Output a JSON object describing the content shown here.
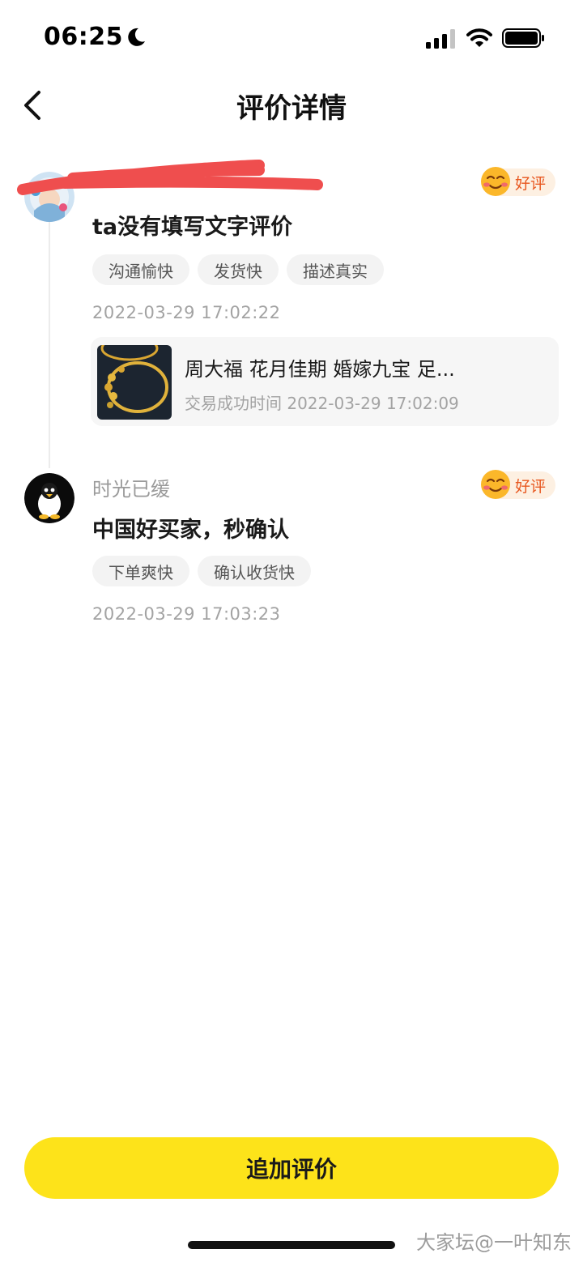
{
  "status_bar": {
    "time": "06:25",
    "icons": [
      "moon-icon",
      "signal-icon",
      "wifi-icon",
      "battery-icon"
    ]
  },
  "nav": {
    "title": "评价详情",
    "back_icon": "chevron-left-icon"
  },
  "reviews": [
    {
      "reviewer_name": "",
      "avatar_icon": "avatar-icon",
      "rating": "好评",
      "text": "ta没有填写文字评价",
      "tags": [
        "沟通愉快",
        "发货快",
        "描述真实"
      ],
      "timestamp": "2022-03-29 17:02:22",
      "product": {
        "name": "周大福 花月佳期 婚嫁九宝 足...",
        "trade_label": "交易成功时间",
        "trade_time": "2022-03-29 17:02:09"
      }
    },
    {
      "reviewer_name": "时光已缓",
      "avatar_icon": "penguin-avatar-icon",
      "rating": "好评",
      "text": "中国好买家，秒确认",
      "tags": [
        "下单爽快",
        "确认收货快"
      ],
      "timestamp": "2022-03-29 17:03:23"
    }
  ],
  "footer": {
    "add_review_label": "追加评价",
    "watermark": "大家坛@一叶知东"
  },
  "colors": {
    "accent_button": "#fde31a",
    "rating_text": "#e8571f",
    "rating_bg": "#fdf0e2",
    "redaction": "#ef4e4e"
  }
}
